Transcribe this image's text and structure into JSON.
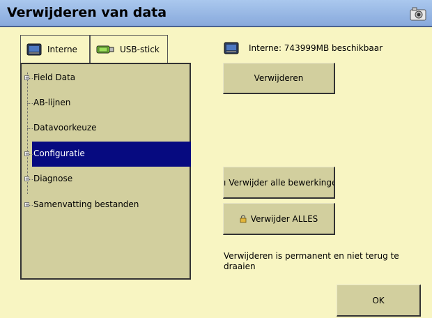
{
  "window": {
    "title": "Verwijderen van data"
  },
  "tabs": [
    {
      "label": "Interne",
      "icon": "monitor-icon",
      "active": true
    },
    {
      "label": "USB-stick",
      "icon": "usb-stick-icon",
      "active": false
    }
  ],
  "tree": {
    "items": [
      {
        "label": "Field Data",
        "expandable": true,
        "selected": false
      },
      {
        "label": "AB-lijnen",
        "expandable": false,
        "selected": false
      },
      {
        "label": "Datavoorkeuze",
        "expandable": false,
        "selected": false
      },
      {
        "label": "Configuratie",
        "expandable": true,
        "selected": true
      },
      {
        "label": "Diagnose",
        "expandable": true,
        "selected": false
      },
      {
        "label": "Samenvatting bestanden",
        "expandable": true,
        "selected": false
      }
    ]
  },
  "storage": {
    "text": "Interne: 743999MB beschikbaar"
  },
  "buttons": {
    "delete": "Verwijderen",
    "delete_all_edits": "Verwijder alle bewerkingen",
    "delete_everything": "Verwijder ALLES",
    "ok": "OK"
  },
  "warning": "Verwijderen is permanent en niet terug te draaien",
  "colors": {
    "background": "#f8f5c2",
    "titlebar": "#99b8e6",
    "selection": "#060a80",
    "panel": "#d2cf9e"
  }
}
